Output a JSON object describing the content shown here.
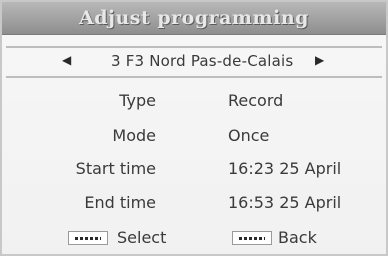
{
  "header": {
    "title": "Adjust programming"
  },
  "channel": {
    "left_arrow": "◀",
    "name": "3 F3 Nord Pas-de-Calais",
    "right_arrow": "▶"
  },
  "fields": {
    "type": {
      "label": "Type",
      "value": "Record"
    },
    "mode": {
      "label": "Mode",
      "value": "Once"
    },
    "start_time": {
      "label": "Start time",
      "value": "16:23 25 April"
    },
    "end_time": {
      "label": "End time",
      "value": "16:53 25 April"
    }
  },
  "footer": {
    "select_label": "Select",
    "back_label": "Back"
  }
}
